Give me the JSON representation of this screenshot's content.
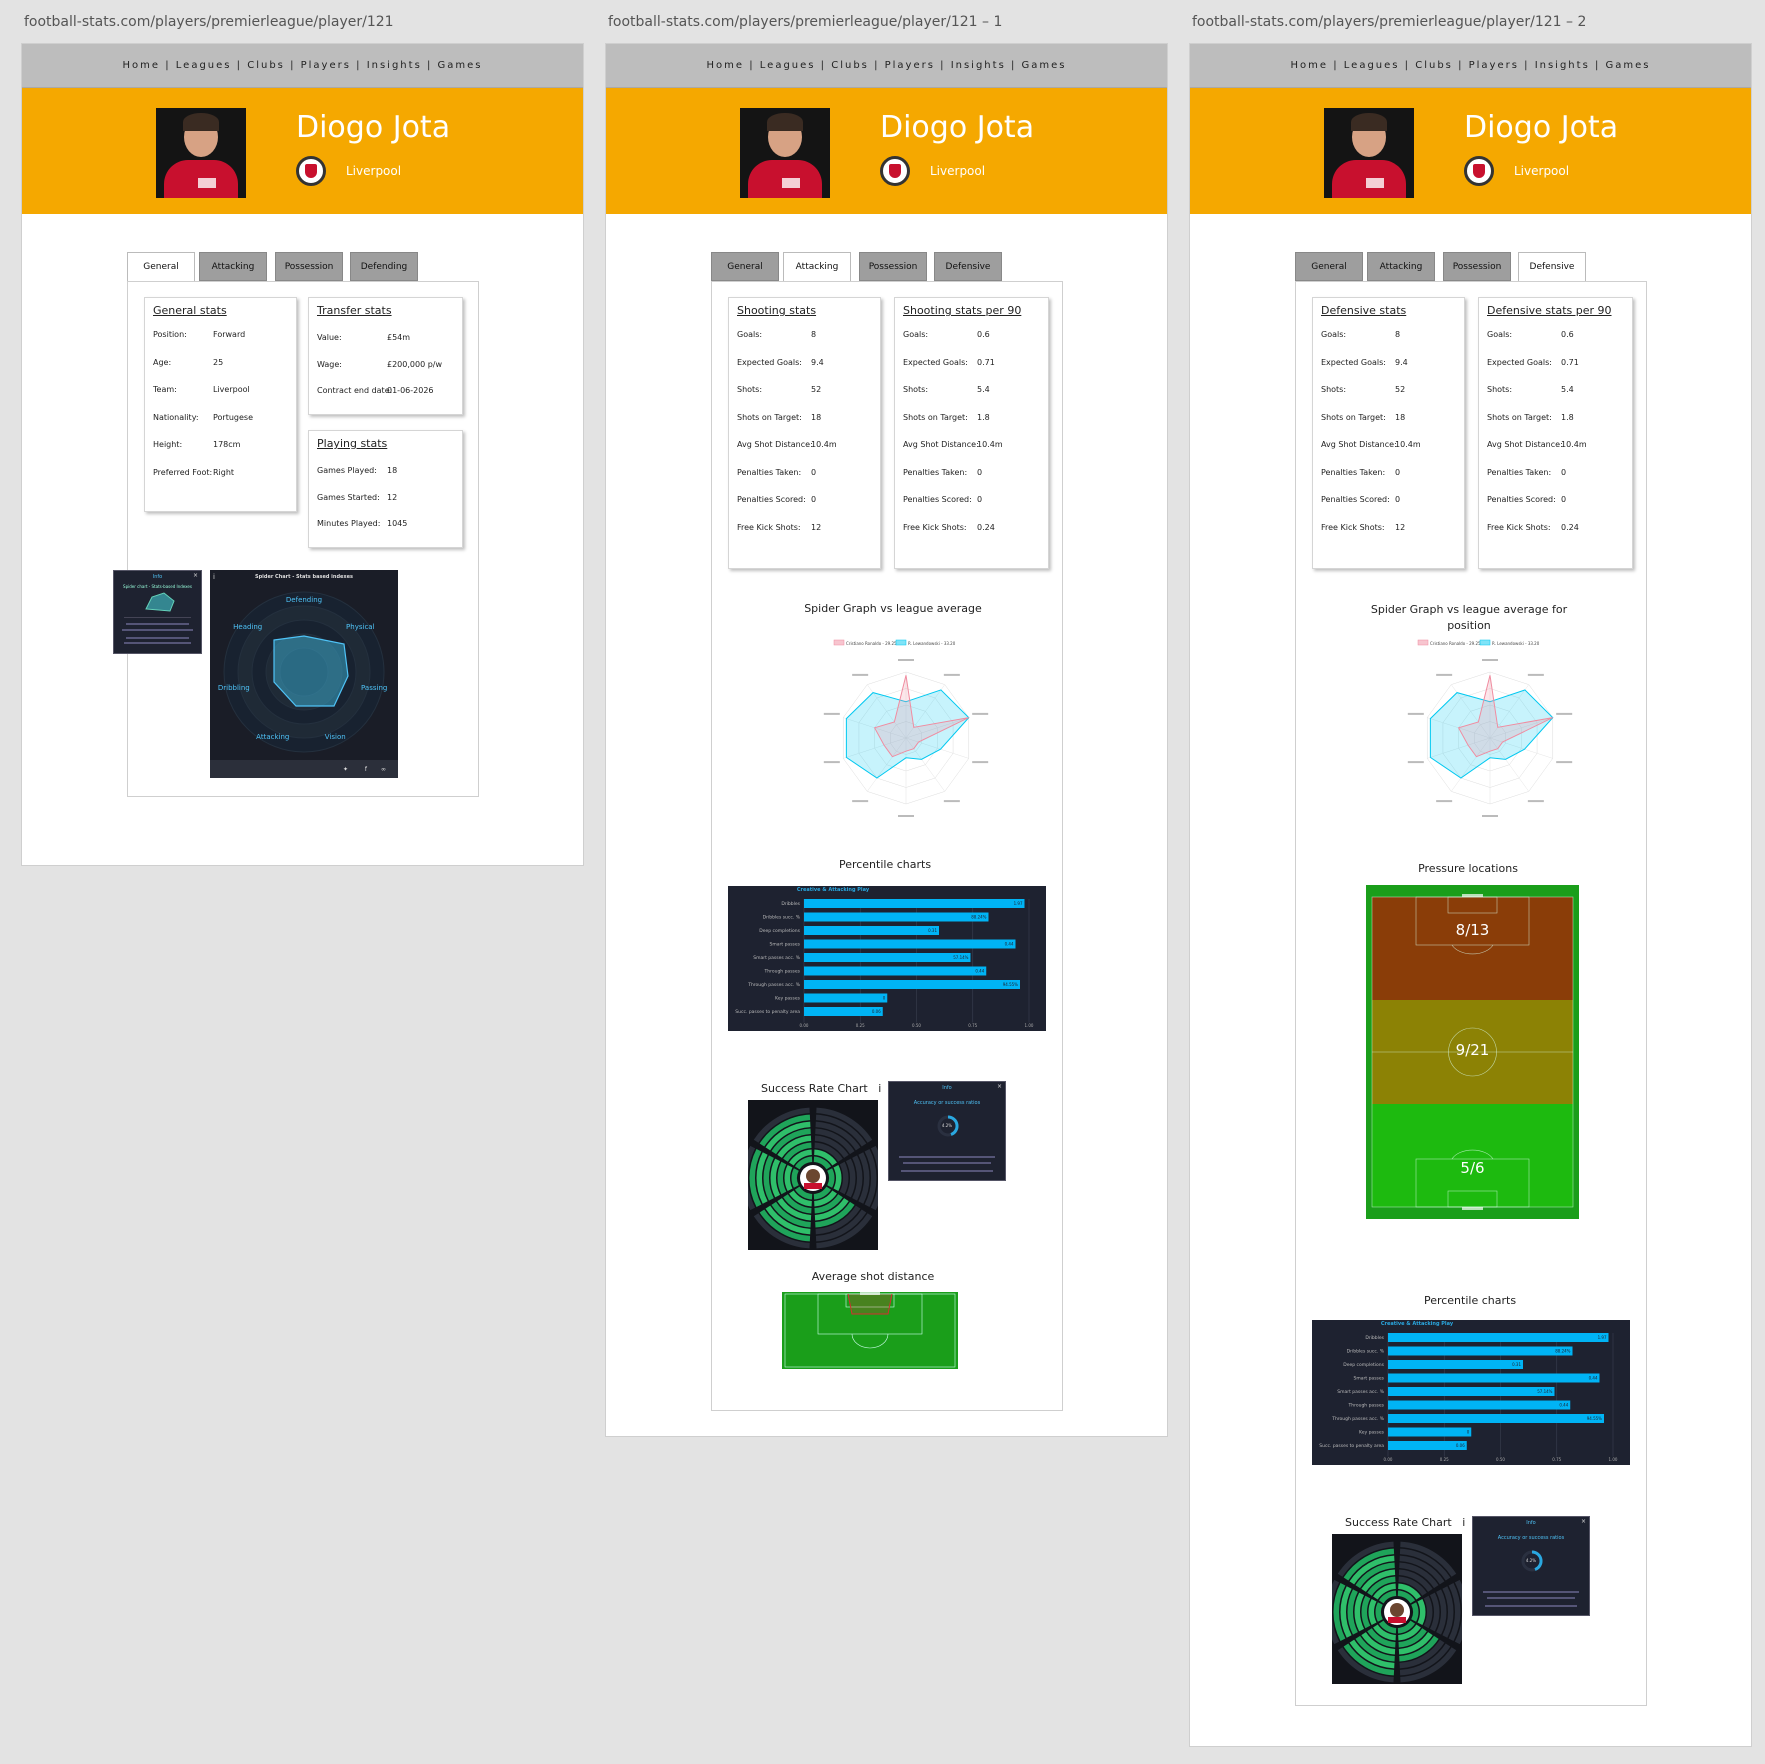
{
  "artboards": [
    {
      "url": "football-stats.com/players/premierleague/player/121"
    },
    {
      "url": "football-stats.com/players/premierleague/player/121 – 1"
    },
    {
      "url": "football-stats.com/players/premierleague/player/121 – 2"
    }
  ],
  "nav": {
    "items": [
      "Home",
      "Leagues",
      "Clubs",
      "Players",
      "Insights",
      "Games"
    ],
    "separator": " | "
  },
  "player": {
    "name": "Diogo Jota",
    "club": "Liverpool"
  },
  "colors": {
    "accent": "#f5a800",
    "nav": "#bdbdbd",
    "tab_inactive": "#9e9e9e",
    "chart_bar": "#00b4f5",
    "dark_panel": "#1e2230",
    "pitch": "#1a9e1a"
  },
  "board1": {
    "tabs": [
      "General",
      "Attacking",
      "Possession",
      "Defending"
    ],
    "active_tab": "General",
    "general_stats": {
      "title": "General stats",
      "rows": [
        {
          "label": "Position:",
          "value": "Forward"
        },
        {
          "label": "Age:",
          "value": "25"
        },
        {
          "label": "Team:",
          "value": "Liverpool"
        },
        {
          "label": "Nationality:",
          "value": "Portugese"
        },
        {
          "label": "Height:",
          "value": "178cm"
        },
        {
          "label": "Preferred Foot:",
          "value": "Right"
        }
      ]
    },
    "transfer_stats": {
      "title": "Transfer stats",
      "rows": [
        {
          "label": "Value:",
          "value": "£54m"
        },
        {
          "label": "Wage:",
          "value": "£200,000 p/w"
        },
        {
          "label": "Contract end date:",
          "value": "01-06-2026"
        }
      ]
    },
    "playing_stats": {
      "title": "Playing stats",
      "rows": [
        {
          "label": "Games Played:",
          "value": "18"
        },
        {
          "label": "Games Started:",
          "value": "12"
        },
        {
          "label": "Minutes Played:",
          "value": "1045"
        }
      ]
    },
    "info_popup": {
      "title": "Info",
      "subtitle": "Spider chart - Stats-based Indexes"
    },
    "spider_chart": {
      "title": "Spider Chart - Stats based indexes",
      "axes": [
        "Defending",
        "Physical",
        "Passing",
        "Vision",
        "Attacking",
        "Dribbling",
        "Heading"
      ],
      "share_icons": [
        "twitter-icon",
        "facebook-icon",
        "link-icon"
      ]
    }
  },
  "board2": {
    "tabs": [
      "General",
      "Attacking",
      "Possession",
      "Defensive"
    ],
    "active_tab": "Attacking",
    "shooting_stats": {
      "title": "Shooting stats",
      "rows": [
        {
          "label": "Goals:",
          "value": "8"
        },
        {
          "label": "Expected Goals:",
          "value": "9.4"
        },
        {
          "label": "Shots:",
          "value": "52"
        },
        {
          "label": "Shots on Target:",
          "value": "18"
        },
        {
          "label": "Avg Shot Distance:",
          "value": "10.4m"
        },
        {
          "label": "Penalties Taken:",
          "value": "0"
        },
        {
          "label": "Penalties Scored:",
          "value": "0"
        },
        {
          "label": "Free Kick Shots:",
          "value": "12"
        }
      ]
    },
    "shooting_per90": {
      "title": "Shooting stats per 90",
      "rows": [
        {
          "label": "Goals:",
          "value": "0.6"
        },
        {
          "label": "Expected Goals:",
          "value": "0.71"
        },
        {
          "label": "Shots:",
          "value": "5.4"
        },
        {
          "label": "Shots on Target:",
          "value": "1.8"
        },
        {
          "label": "Avg Shot Distance:",
          "value": "10.4m"
        },
        {
          "label": "Penalties Taken:",
          "value": "0"
        },
        {
          "label": "Penalties Scored:",
          "value": "0"
        },
        {
          "label": "Free Kick Shots:",
          "value": "0.24"
        }
      ]
    },
    "spider_title": "Spider Graph vs league average",
    "percentile_title": "Percentile charts",
    "success_title": "Success Rate Chart",
    "info_icon": "i",
    "success_info": {
      "title": "Info",
      "subtitle": "Accuracy or success ratios",
      "value": "4.2%"
    },
    "avg_shot_title": "Average shot distance"
  },
  "board3": {
    "tabs": [
      "General",
      "Attacking",
      "Possession",
      "Defensive"
    ],
    "active_tab": "Defensive",
    "defensive_stats": {
      "title": "Defensive stats",
      "rows": [
        {
          "label": "Goals:",
          "value": "8"
        },
        {
          "label": "Expected Goals:",
          "value": "9.4"
        },
        {
          "label": "Shots:",
          "value": "52"
        },
        {
          "label": "Shots on Target:",
          "value": "18"
        },
        {
          "label": "Avg Shot Distance:",
          "value": "10.4m"
        },
        {
          "label": "Penalties Taken:",
          "value": "0"
        },
        {
          "label": "Penalties Scored:",
          "value": "0"
        },
        {
          "label": "Free Kick Shots:",
          "value": "12"
        }
      ]
    },
    "defensive_per90": {
      "title": "Defensive stats per 90",
      "rows": [
        {
          "label": "Goals:",
          "value": "0.6"
        },
        {
          "label": "Expected Goals:",
          "value": "0.71"
        },
        {
          "label": "Shots:",
          "value": "5.4"
        },
        {
          "label": "Shots on Target:",
          "value": "1.8"
        },
        {
          "label": "Avg Shot Distance:",
          "value": "10.4m"
        },
        {
          "label": "Penalties Taken:",
          "value": "0"
        },
        {
          "label": "Penalties Scored:",
          "value": "0"
        },
        {
          "label": "Free Kick Shots:",
          "value": "0.24"
        }
      ]
    },
    "spider_title_line1": "Spider Graph vs league average for",
    "spider_title_line2": "position",
    "pressure_title": "Pressure locations",
    "pressure_zones": [
      {
        "zone": "attacking third",
        "value": "8/13",
        "color": "#8a3d08"
      },
      {
        "zone": "middle third",
        "value": "9/21",
        "color": "#8c8205"
      },
      {
        "zone": "defensive third",
        "value": "5/6",
        "color": "#1dba0f"
      }
    ],
    "percentile_title": "Percentile charts",
    "success_title": "Success Rate Chart",
    "info_icon": "i",
    "success_info": {
      "title": "Info",
      "subtitle": "Accuracy or success ratios",
      "value": "4.2%"
    }
  },
  "chart_data": {
    "type": "bar",
    "title": "Creative & Attacking Play",
    "categories": [
      "Dribbles",
      "Dribbles succ. %",
      "Deep completions",
      "Smart passes",
      "Smart passes acc. %",
      "Through passes",
      "Through passes acc. %",
      "Key passes",
      "Succ. passes to penalty area"
    ],
    "values": [
      0.98,
      0.82,
      0.6,
      0.94,
      0.74,
      0.81,
      0.96,
      0.37,
      0.35
    ],
    "value_labels": [
      "1.97",
      "88.24%",
      "0.31",
      "0.44",
      "57.14%",
      "0.44",
      "94.55%",
      "0",
      "0.06"
    ],
    "xlim": [
      0,
      1
    ],
    "xticks": [
      "0.00",
      "0.25",
      "0.50",
      "0.75",
      "1.00"
    ]
  },
  "spider_compare": {
    "type": "radar",
    "series": [
      {
        "name": "Cristiano Ronaldo - 29.25",
        "color": "#f08ca0",
        "values": [
          0.95,
          0.2,
          1.0,
          0.2,
          0.2,
          0.2,
          0.35,
          0.35,
          0.5,
          0.3
        ]
      },
      {
        "name": "R. Lewandowski - 33.20",
        "color": "#00c8f0",
        "values": [
          0.55,
          0.9,
          1.0,
          0.55,
          0.4,
          0.3,
          0.75,
          0.95,
          0.95,
          0.85
        ]
      }
    ]
  }
}
